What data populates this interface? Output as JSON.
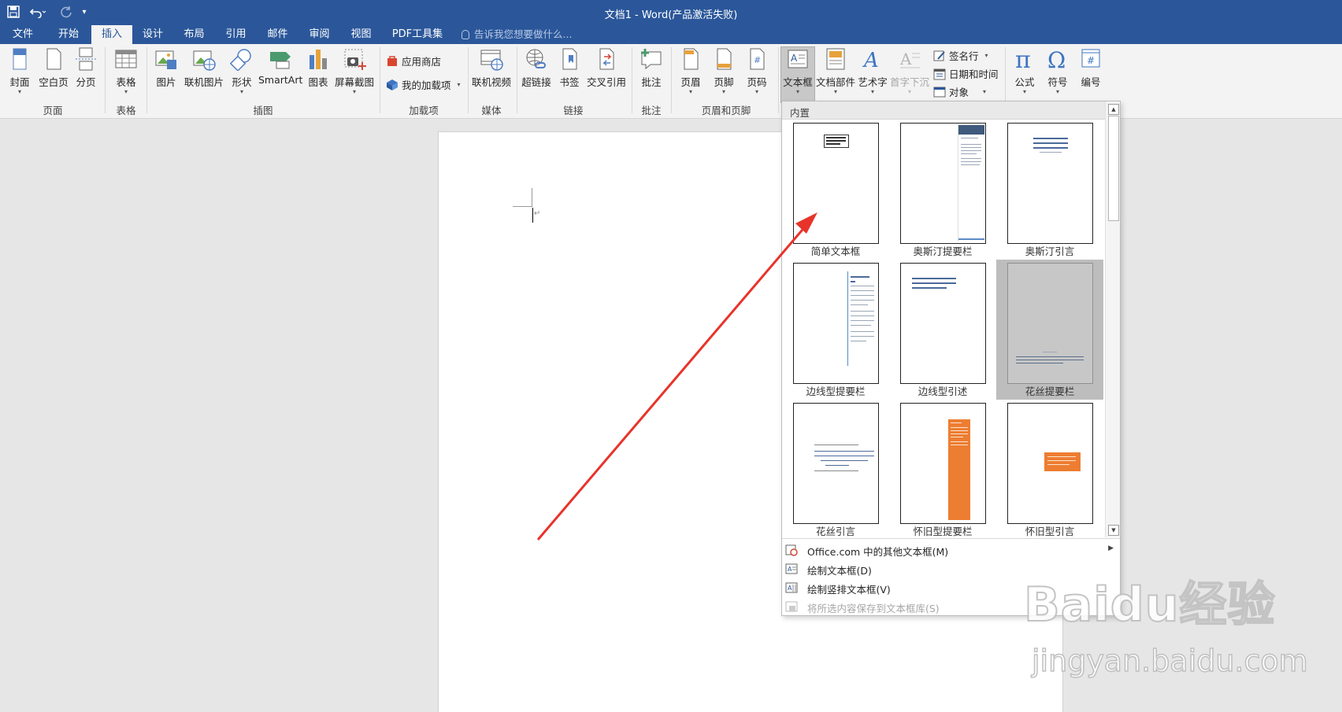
{
  "app": {
    "title": "文档1 - Word(产品激活失败)",
    "qat": {
      "save_icon": "save-icon",
      "undo_icon": "undo-icon",
      "redo_icon": "redo-icon",
      "customize_icon": "customize-qat-icon"
    }
  },
  "tabs": [
    {
      "label": "文件"
    },
    {
      "label": "开始"
    },
    {
      "label": "插入",
      "active": true
    },
    {
      "label": "设计"
    },
    {
      "label": "布局"
    },
    {
      "label": "引用"
    },
    {
      "label": "邮件"
    },
    {
      "label": "审阅"
    },
    {
      "label": "视图"
    },
    {
      "label": "PDF工具集"
    }
  ],
  "tell_me": {
    "placeholder": "告诉我您想要做什么..."
  },
  "ribbon": {
    "groups": {
      "pages": "页面",
      "tables": "表格",
      "illustrations": "插图",
      "addins": "加载项",
      "media": "媒体",
      "links": "链接",
      "comments": "批注",
      "header_footer": "页眉和页脚"
    },
    "buttons": {
      "cover": "封面",
      "blank_page": "空白页",
      "page_break": "分页",
      "table": "表格",
      "picture": "图片",
      "online_picture": "联机图片",
      "shapes": "形状",
      "smartart": "SmartArt",
      "chart": "图表",
      "screenshot": "屏幕截图",
      "store": "应用商店",
      "my_addins": "我的加载项",
      "online_video": "联机视频",
      "hyperlink": "超链接",
      "bookmark": "书签",
      "cross_ref": "交叉引用",
      "comment": "批注",
      "header": "页眉",
      "footer": "页脚",
      "page_number": "页码",
      "text_box": "文本框",
      "quick_parts": "文档部件",
      "wordart": "艺术字",
      "drop_cap": "首字下沉",
      "signature_line": "签名行",
      "date_time": "日期和时间",
      "object": "对象",
      "equation": "公式",
      "symbol": "符号",
      "numbering": "编号"
    }
  },
  "dropdown": {
    "section_label": "内置",
    "tiles": [
      {
        "name": "简单文本框"
      },
      {
        "name": "奥斯汀提要栏"
      },
      {
        "name": "奥斯汀引言"
      },
      {
        "name": "边线型提要栏"
      },
      {
        "name": "边线型引述"
      },
      {
        "name": "花丝提要栏"
      },
      {
        "name": "花丝引言"
      },
      {
        "name": "怀旧型提要栏"
      },
      {
        "name": "怀旧型引言"
      }
    ],
    "menu": [
      {
        "label": "Office.com 中的其他文本框(M)",
        "icon": "office-com-icon"
      },
      {
        "label": "绘制文本框(D)",
        "icon": "draw-textbox-icon"
      },
      {
        "label": "绘制竖排文本框(V)",
        "icon": "draw-vertical-textbox-icon"
      },
      {
        "label": "将所选内容保存到文本框库(S)",
        "icon": "save-selection-icon",
        "disabled": true
      }
    ]
  },
  "watermark": {
    "logo": "Baidu经验",
    "url": "jingyan.baidu.com"
  },
  "colors": {
    "brand": "#2b579a",
    "orange": "#ed7d31",
    "arrow": "#e8332a"
  }
}
